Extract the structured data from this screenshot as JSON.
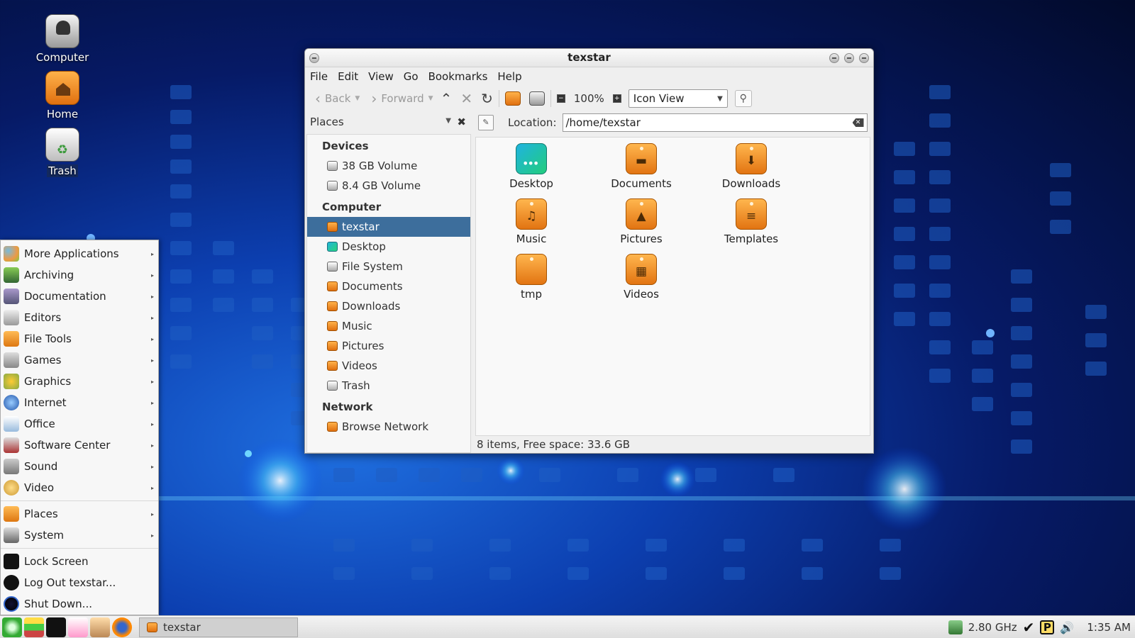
{
  "desktop": {
    "icons": [
      {
        "label": "Computer"
      },
      {
        "label": "Home"
      },
      {
        "label": "Trash"
      }
    ]
  },
  "window": {
    "title": "texstar",
    "menu": [
      "File",
      "Edit",
      "View",
      "Go",
      "Bookmarks",
      "Help"
    ],
    "toolbar": {
      "back": "Back",
      "forward": "Forward",
      "zoom": "100%",
      "view_mode": "Icon View"
    },
    "sidebar": {
      "header": "Places",
      "sections": {
        "devices": "Devices",
        "computer": "Computer",
        "network": "Network"
      },
      "devices": [
        "38 GB Volume",
        "8.4 GB Volume"
      ],
      "computer": [
        "texstar",
        "Desktop",
        "File System",
        "Documents",
        "Downloads",
        "Music",
        "Pictures",
        "Videos",
        "Trash"
      ],
      "network": [
        "Browse Network"
      ]
    },
    "location": {
      "label": "Location:",
      "value": "/home/texstar"
    },
    "files": [
      "Desktop",
      "Documents",
      "Downloads",
      "Music",
      "Pictures",
      "Templates",
      "tmp",
      "Videos"
    ],
    "status": "8 items, Free space: 33.6 GB"
  },
  "app_menu": {
    "items": [
      "More Applications",
      "Archiving",
      "Documentation",
      "Editors",
      "File Tools",
      "Games",
      "Graphics",
      "Internet",
      "Office",
      "Software Center",
      "Sound",
      "Video"
    ],
    "places": [
      "Places",
      "System"
    ],
    "session": [
      "Lock Screen",
      "Log Out texstar...",
      "Shut Down..."
    ]
  },
  "taskbar": {
    "task": "texstar",
    "cpu_freq": "2.80 GHz",
    "clock": "1:35 AM"
  }
}
